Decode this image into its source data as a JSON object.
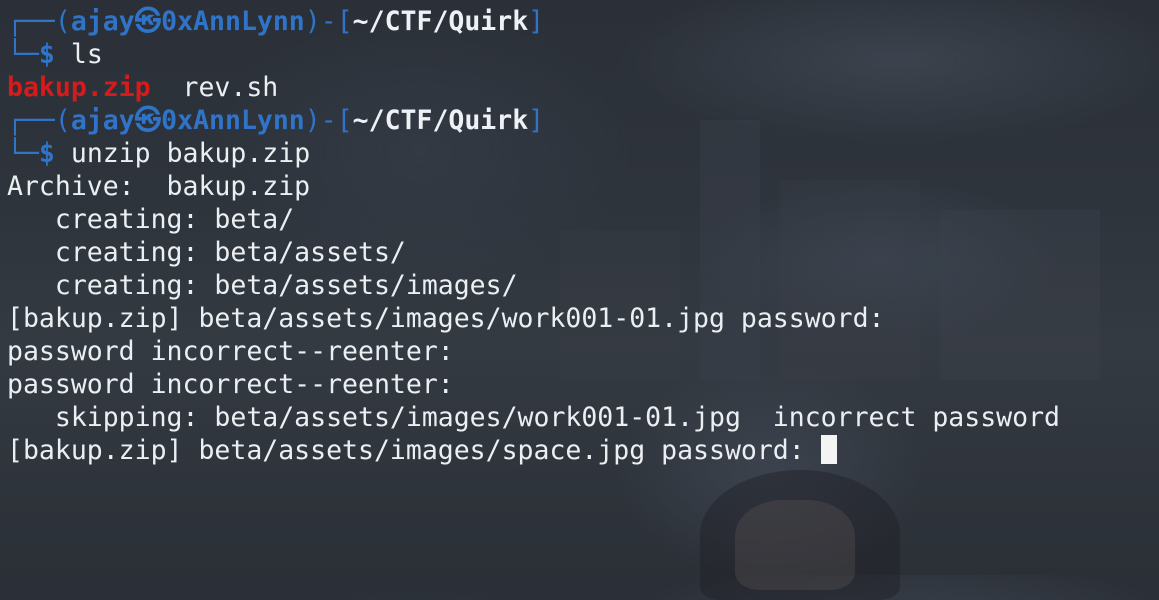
{
  "prompt": {
    "top_corner": "┌──",
    "bottom_corner": "└─",
    "open_paren": "(",
    "user": "ajay",
    "at_symbol": "㉿",
    "host": "0xAnnLynn",
    "close_paren": ")",
    "dash": "-",
    "open_bracket": "[",
    "cwd": "~/CTF/Quirk",
    "close_bracket": "]",
    "dollar": "$"
  },
  "commands": {
    "first": "ls",
    "second": "unzip bakup.zip"
  },
  "ls_output": {
    "zip_entry": "bakup.zip",
    "separator": "  ",
    "script_entry": "rev.sh"
  },
  "unzip_output": [
    "Archive:  bakup.zip",
    "   creating: beta/",
    "   creating: beta/assets/",
    "   creating: beta/assets/images/",
    "[bakup.zip] beta/assets/images/work001-01.jpg password:",
    "password incorrect--reenter:",
    "password incorrect--reenter:",
    "   skipping: beta/assets/images/work001-01.jpg  incorrect password"
  ],
  "current_prompt": "[bakup.zip] beta/assets/images/space.jpg password: ",
  "colors": {
    "prompt_blue": "#2f74c8",
    "zip_red": "#d51b1b",
    "text": "#eceff2",
    "cursor": "#f4f4f4"
  }
}
